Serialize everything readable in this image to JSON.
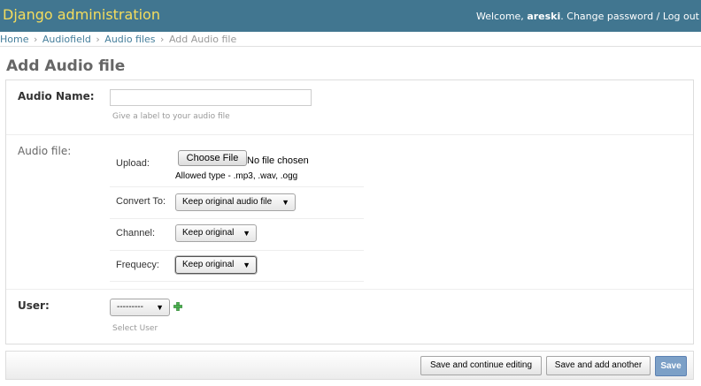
{
  "header": {
    "site_title": "Django administration",
    "welcome_prefix": "Welcome,",
    "username": "areski",
    "change_password": "Change password",
    "divider": "/",
    "logout": "Log out"
  },
  "breadcrumbs": {
    "items": [
      "Home",
      "Audiofield",
      "Audio files",
      "Add Audio file"
    ],
    "separator": "›"
  },
  "page_title": "Add Audio file",
  "form": {
    "audio_name": {
      "label": "Audio Name:",
      "value": "",
      "help": "Give a label to your audio file"
    },
    "audio_file": {
      "label": "Audio file:",
      "upload_label": "Upload:",
      "choose_file_label": "Choose File",
      "no_file_text": "No file chosen",
      "allowed_type": "Allowed type - .mp3, .wav, .ogg",
      "convert_label": "Convert To:",
      "convert_value": "Keep original audio file",
      "channel_label": "Channel:",
      "channel_value": "Keep original",
      "frequency_label": "Frequecy:",
      "frequency_value": "Keep original"
    },
    "user": {
      "label": "User:",
      "value": "---------",
      "help": "Select User"
    }
  },
  "submit_row": {
    "save_continue": "Save and continue editing",
    "save_add_another": "Save and add another",
    "save": "Save"
  },
  "icons": {
    "dropdown_arrow": "▼",
    "add_icon": "plus-icon"
  },
  "colors": {
    "header_bg": "#417690",
    "site_title": "#f5dd5d",
    "link": "#447e9b",
    "save_button": "#7ca0c7",
    "add_icon": "#4caf50"
  }
}
